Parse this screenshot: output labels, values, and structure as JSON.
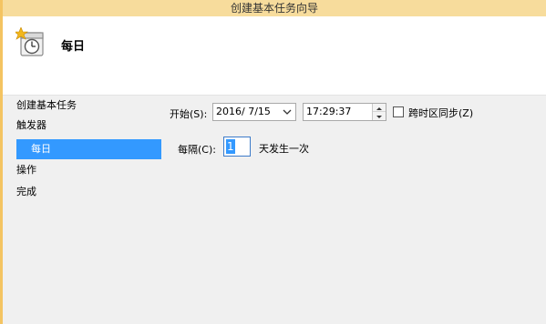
{
  "window": {
    "title": "创建基本任务向导"
  },
  "header": {
    "title": "每日",
    "icon": "calendar-clock-icon"
  },
  "nav": {
    "items": [
      {
        "label": "创建基本任务"
      },
      {
        "label": "触发器"
      },
      {
        "label": "每日",
        "selected": true
      },
      {
        "label": "操作"
      },
      {
        "label": "完成"
      }
    ]
  },
  "form": {
    "start_label": "开始(S):",
    "start_date": "2016/  7/15",
    "start_time": "17:29:37",
    "sync_label": "跨时区同步(Z)",
    "sync_checked": false,
    "recur_label": "每隔(C):",
    "recur_value": "1",
    "recur_suffix": "天发生一次"
  },
  "colors": {
    "titlebar": "#f7dc9c",
    "frame": "#f4c462",
    "selection": "#3399ff",
    "background": "#f0f0f0"
  }
}
